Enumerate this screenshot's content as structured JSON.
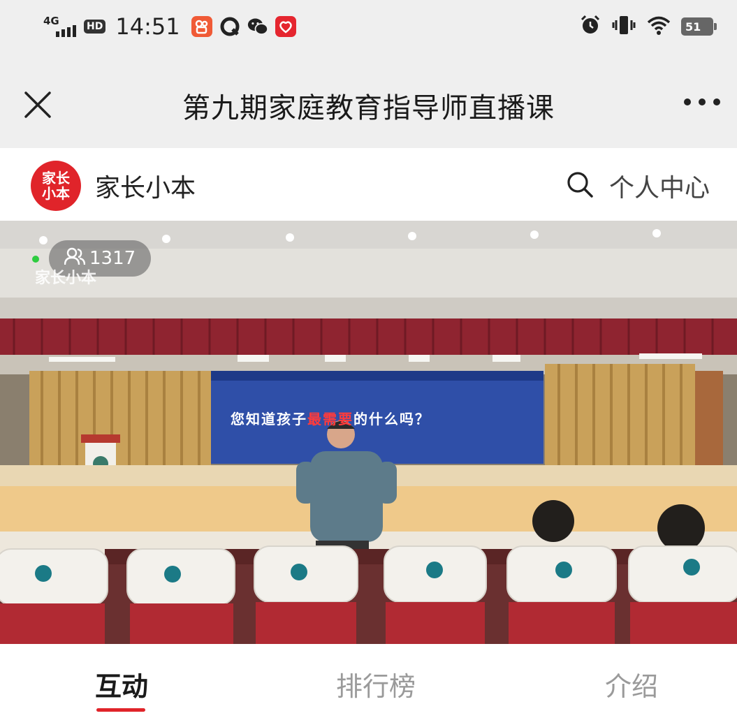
{
  "status_bar": {
    "network": "4G",
    "hd": "HD",
    "time": "14:51",
    "battery": "51",
    "apps": [
      "kuaishou-icon",
      "qq-browser-icon",
      "wechat-icon",
      "app-red-icon"
    ],
    "right_icons": [
      "alarm-icon",
      "vibrate-icon",
      "wifi-icon",
      "battery-icon"
    ]
  },
  "nav": {
    "title": "第九期家庭教育指导师直播课",
    "close_icon": "close-icon",
    "more_icon": "more-icon"
  },
  "brand": {
    "logo_line1": "家长",
    "logo_line2": "小本",
    "name": "家长小本",
    "personal_center": "个人中心",
    "logo_color": "#e0242a"
  },
  "video": {
    "viewer_count": "1317",
    "watermark": "家长小本",
    "slide_text_before": "您知道孩子",
    "slide_text_highlight": "最需要",
    "slide_text_after": "的什么吗？"
  },
  "tabs": {
    "items": [
      {
        "label": "互动",
        "active": true
      },
      {
        "label": "排行榜",
        "active": false
      },
      {
        "label": "介绍",
        "active": false
      }
    ],
    "accent": "#e0242a"
  }
}
